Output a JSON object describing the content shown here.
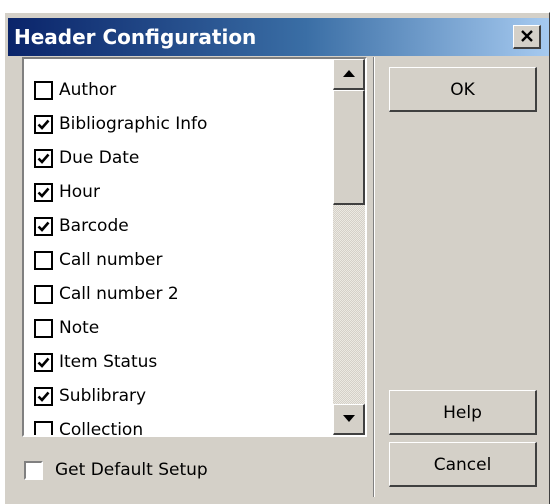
{
  "window": {
    "title": "Header Configuration"
  },
  "list": {
    "items": [
      {
        "label": "Author",
        "checked": false
      },
      {
        "label": "Bibliographic Info",
        "checked": true
      },
      {
        "label": "Due Date",
        "checked": true
      },
      {
        "label": "Hour",
        "checked": true
      },
      {
        "label": "Barcode",
        "checked": true
      },
      {
        "label": "Call number",
        "checked": false
      },
      {
        "label": "Call number 2",
        "checked": false
      },
      {
        "label": "Note",
        "checked": false
      },
      {
        "label": "Item Status",
        "checked": true
      },
      {
        "label": "Sublibrary",
        "checked": true
      },
      {
        "label": "Collection",
        "checked": false
      }
    ]
  },
  "options": {
    "default_setup_label": "Get Default Setup",
    "default_setup_checked": false
  },
  "buttons": {
    "ok": "OK",
    "help": "Help",
    "cancel": "Cancel"
  },
  "colors": {
    "title_gradient_start": "#0a246a",
    "title_gradient_end": "#a6caf0",
    "dialog_face": "#d4d0c8"
  }
}
